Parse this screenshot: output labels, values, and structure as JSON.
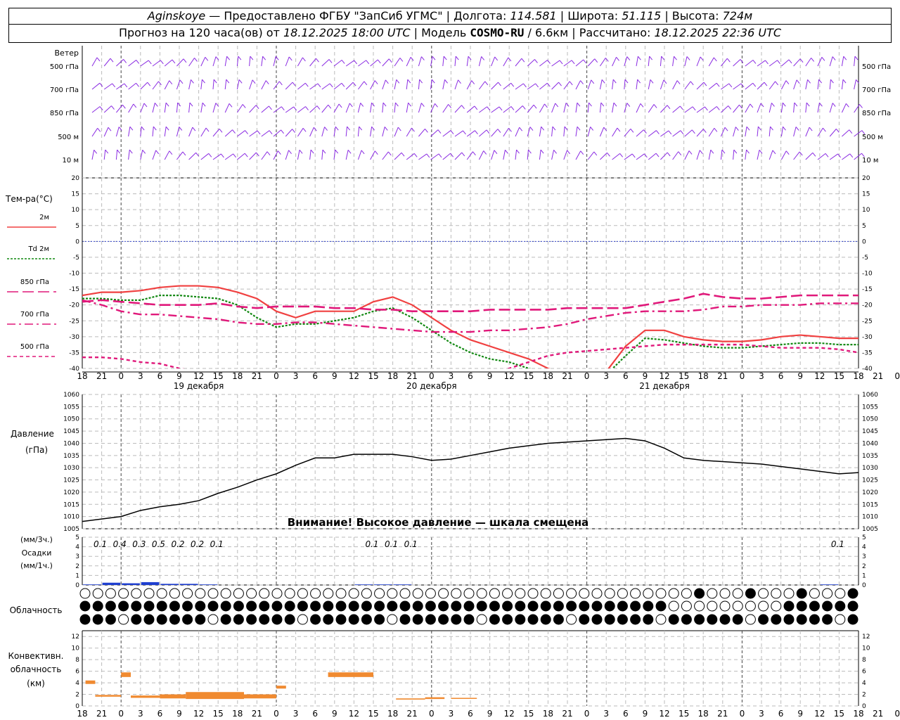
{
  "header": {
    "station": "Aginskoye",
    "provider": " — Предоставлено ФГБУ \"ЗапСиб УГМС\" | Долгота: ",
    "lon": "114.581",
    "lat_label": " | Широта: ",
    "lat": "51.115",
    "alt_label": " | Высота: ",
    "alt": "724м",
    "forecast_label": "Прогноз на 120 часа(ов) от ",
    "forecast_start": "18.12.2025 18:00 UTC",
    "model_label": " | Модель ",
    "model": "COSMO-RU",
    "model_res": " / 6.6км",
    "calc_label": " | Рассчитано: ",
    "calc_time": "18.12.2025 22:36 UTC"
  },
  "colors": {
    "wind": "#8a2be2",
    "t2m": "#f04040",
    "td2m": "#118811",
    "t850": "#e0187a",
    "t700": "#e0187a",
    "t500": "#e0187a",
    "zero": "#3344cc",
    "pressure": "#000000",
    "precip": "#1f3fd0",
    "convective": "#f08a30"
  },
  "chart_data": [
    {
      "type": "wind-barbs",
      "title": "Ветер",
      "levels": [
        "500 гПа",
        "700 гПа",
        "850 гПа",
        "500 м",
        "10  м"
      ],
      "x_hours": [
        0,
        120
      ]
    },
    {
      "type": "line",
      "title": "Тем-ра(°C)",
      "ylim": [
        -40,
        20
      ],
      "yticks": [
        -40,
        -35,
        -30,
        -25,
        -20,
        -15,
        -10,
        -5,
        0,
        5,
        10,
        15,
        20
      ],
      "legend": [
        {
          "label": "2м",
          "key": "t2m",
          "dash": ""
        },
        {
          "label": "Td  2м",
          "key": "td2m",
          "dash": "3,2"
        },
        {
          "label": "850 гПа",
          "key": "t850",
          "dash": "16,6"
        },
        {
          "label": "700 гПа",
          "key": "t700",
          "dash": "12,5,3,5"
        },
        {
          "label": "500 гПа",
          "key": "t500",
          "dash": "5,4"
        }
      ],
      "x_hours": [
        0,
        3,
        6,
        9,
        12,
        15,
        18,
        21,
        24,
        27,
        30,
        33,
        36,
        39,
        42,
        45,
        48,
        51,
        54,
        57,
        60,
        63,
        66,
        69,
        72,
        75,
        78,
        81,
        84,
        87,
        90,
        93,
        96,
        99,
        102,
        105,
        108,
        111,
        114,
        117,
        120
      ],
      "series": [
        {
          "key": "t2m",
          "values": [
            -17,
            -16,
            -16,
            -15.5,
            -14.5,
            -14,
            -14,
            -14.5,
            -16,
            -18,
            -22,
            -24,
            -22,
            -22,
            -22,
            -19,
            -17.5,
            -20,
            -24,
            -28,
            -31,
            -33,
            -35,
            -37,
            -40,
            -42,
            -44,
            -41,
            -33,
            -28,
            -28,
            -30,
            -31,
            -31.5,
            -31.5,
            -31,
            -30,
            -29.5,
            -30,
            -30.5,
            -30.5
          ]
        },
        {
          "key": "td2m",
          "values": [
            -18,
            -18,
            -18.5,
            -18.5,
            -17,
            -17,
            -17.5,
            -18,
            -20,
            -24,
            -27,
            -26,
            -26,
            -25,
            -24,
            -22,
            -21,
            -24,
            -28,
            -32,
            -35,
            -37,
            -38,
            -40,
            -42,
            -44,
            -45,
            -42,
            -36,
            -30.5,
            -31,
            -32,
            -33,
            -33.5,
            -33.5,
            -33,
            -32.5,
            -32,
            -32,
            -32.5,
            -32.5
          ]
        },
        {
          "key": "t850",
          "values": [
            -19,
            -18.5,
            -19,
            -19.5,
            -20,
            -20,
            -20,
            -19.5,
            -20.5,
            -21,
            -20.5,
            -20.5,
            -20.5,
            -21,
            -21,
            -21.5,
            -21.5,
            -22,
            -22,
            -22,
            -22,
            -21.5,
            -21.5,
            -21.5,
            -21.5,
            -21,
            -21,
            -21,
            -21,
            -20,
            -19,
            -18,
            -16.5,
            -17.5,
            -18,
            -18,
            -17.5,
            -17,
            -17,
            -17,
            -17
          ]
        },
        {
          "key": "t700",
          "values": [
            -18.5,
            -20,
            -22,
            -23,
            -23,
            -23.5,
            -24,
            -24.5,
            -25.5,
            -26,
            -26,
            -25.5,
            -25.5,
            -26,
            -26.5,
            -27,
            -27.5,
            -28,
            -28.5,
            -28.5,
            -28.5,
            -28,
            -28,
            -27.5,
            -27,
            -26,
            -24.5,
            -23.5,
            -22.5,
            -22,
            -22,
            -22,
            -21.5,
            -20.5,
            -20.5,
            -20,
            -20,
            -20,
            -19.5,
            -19.5,
            -19.5
          ]
        },
        {
          "key": "t500",
          "values": [
            -36.5,
            -36.5,
            -37,
            -38,
            -38.5,
            -40,
            -41,
            -42,
            -43,
            -44,
            -45,
            -46,
            -47,
            -47,
            -47,
            -46,
            -45,
            -44,
            -43,
            -43,
            -42.5,
            -41,
            -40,
            -38,
            -36,
            -35,
            -34.5,
            -34,
            -33.5,
            -33,
            -32.5,
            -32.5,
            -32.5,
            -32.5,
            -32.5,
            -33,
            -33.5,
            -33.5,
            -33.5,
            -34,
            -35
          ]
        }
      ]
    },
    {
      "type": "line",
      "title": "Давление",
      "units": "(гПа)",
      "ylim": [
        1005,
        1060
      ],
      "yticks": [
        1005,
        1010,
        1015,
        1020,
        1025,
        1030,
        1035,
        1040,
        1045,
        1050,
        1055,
        1060
      ],
      "note": "Внимание! Высокое давление — шкала смещена",
      "x_hours": [
        0,
        3,
        6,
        9,
        12,
        15,
        18,
        21,
        24,
        27,
        30,
        33,
        36,
        39,
        42,
        45,
        48,
        51,
        54,
        57,
        60,
        63,
        66,
        69,
        72,
        75,
        78,
        81,
        84,
        87,
        90,
        93,
        96,
        99,
        102,
        105,
        108,
        111,
        114,
        117,
        120
      ],
      "values": [
        1008,
        1009,
        1010,
        1012.5,
        1014,
        1015,
        1016.5,
        1019.5,
        1022,
        1025,
        1027.5,
        1031,
        1034,
        1034,
        1035.5,
        1035.5,
        1035.5,
        1034.5,
        1033,
        1033.5,
        1035,
        1036.5,
        1038,
        1039,
        1040,
        1040.5,
        1041,
        1041.5,
        1042,
        1041,
        1038,
        1034,
        1033,
        1032.5,
        1032,
        1031.5,
        1030.5,
        1029.5,
        1028.5,
        1027.5,
        1028
      ]
    },
    {
      "type": "bar",
      "title": "Осадки",
      "units_3h": "(мм/3ч.)",
      "units_1h": "(мм/1ч.)",
      "ylim": [
        0,
        5
      ],
      "yticks": [
        0,
        1,
        2,
        3,
        4,
        5
      ],
      "x_hours": [
        3,
        6,
        9,
        12,
        15,
        18,
        21,
        45,
        48,
        51,
        117
      ],
      "values": [
        0.1,
        0.4,
        0.3,
        0.5,
        0.2,
        0.2,
        0.1,
        0.1,
        0.1,
        0.1,
        0.1
      ],
      "labels": [
        "0.1",
        "0.4",
        "0.3",
        "0.5",
        "0.2",
        "0.2",
        "0.1",
        "0.1",
        "0.1",
        "0.1",
        "0.1"
      ]
    },
    {
      "type": "symbols",
      "title": "Облачность",
      "rows": [
        "upper",
        "middle",
        "lower"
      ]
    },
    {
      "type": "bar",
      "title": "Конвективн. облачность",
      "units": "(км)",
      "ylim": [
        0,
        13
      ],
      "yticks": [
        0,
        2,
        4,
        6,
        8,
        10,
        12
      ],
      "segments": [
        {
          "x0": 0.5,
          "x1": 2,
          "bottom": 3.8,
          "top": 4.4
        },
        {
          "x0": 2,
          "x1": 6,
          "bottom": 1.6,
          "top": 1.9
        },
        {
          "x0": 6,
          "x1": 7.5,
          "bottom": 5,
          "top": 5.8
        },
        {
          "x0": 7.5,
          "x1": 12,
          "bottom": 1.4,
          "top": 1.8
        },
        {
          "x0": 12,
          "x1": 16,
          "bottom": 1.3,
          "top": 2.0
        },
        {
          "x0": 16,
          "x1": 25,
          "bottom": 1.2,
          "top": 2.4
        },
        {
          "x0": 25,
          "x1": 30,
          "bottom": 1.3,
          "top": 2.0
        },
        {
          "x0": 30,
          "x1": 31.5,
          "bottom": 3.0,
          "top": 3.5
        },
        {
          "x0": 38,
          "x1": 45,
          "bottom": 5,
          "top": 5.8
        },
        {
          "x0": 48.5,
          "x1": 53,
          "bottom": 1.1,
          "top": 1.3
        },
        {
          "x0": 53,
          "x1": 56,
          "bottom": 1.2,
          "top": 1.5
        },
        {
          "x0": 57,
          "x1": 61,
          "bottom": 1.3,
          "top": 1.4
        }
      ]
    }
  ],
  "time_axis": {
    "hour_labels": [
      "18",
      "21",
      "0",
      "3",
      "6",
      "9",
      "12",
      "15",
      "18",
      "21",
      "0",
      "3",
      "6",
      "9",
      "12",
      "15",
      "18",
      "21",
      "0",
      "3",
      "6",
      "9",
      "12",
      "15",
      "18",
      "21",
      "0",
      "3",
      "6",
      "9",
      "12",
      "15",
      "18",
      "21",
      "0",
      "3",
      "6",
      "9",
      "12",
      "15",
      "18",
      "21",
      "0"
    ],
    "day_labels": [
      {
        "text": "19 декабря",
        "hour": 18
      },
      {
        "text": "20 декабря",
        "hour": 54
      },
      {
        "text": "21 декабря",
        "hour": 90
      }
    ]
  }
}
